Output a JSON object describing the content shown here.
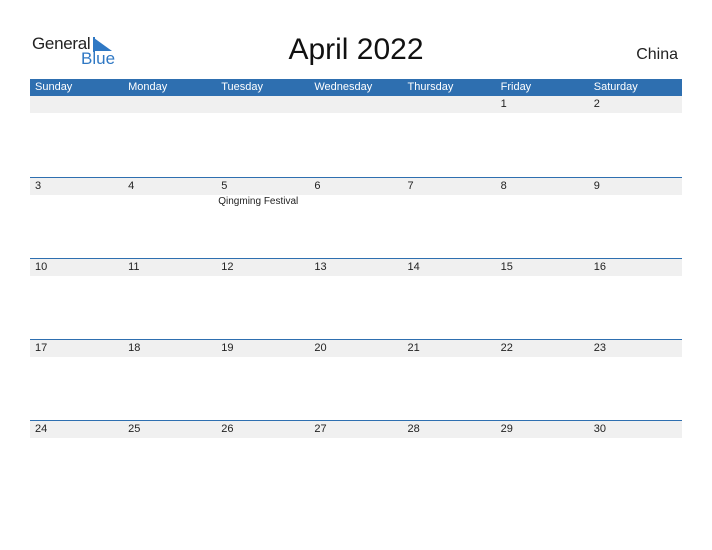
{
  "logo": {
    "word1": "General",
    "word2": "Blue"
  },
  "title": "April 2022",
  "country": "China",
  "colors": {
    "accent": "#2e6fb0",
    "strip": "#f0f0f0"
  },
  "weekdays": [
    "Sunday",
    "Monday",
    "Tuesday",
    "Wednesday",
    "Thursday",
    "Friday",
    "Saturday"
  ],
  "weeks": [
    {
      "days": [
        "",
        "",
        "",
        "",
        "",
        "1",
        "2"
      ],
      "events": [
        "",
        "",
        "",
        "",
        "",
        "",
        ""
      ]
    },
    {
      "days": [
        "3",
        "4",
        "5",
        "6",
        "7",
        "8",
        "9"
      ],
      "events": [
        "",
        "",
        "Qingming Festival",
        "",
        "",
        "",
        ""
      ]
    },
    {
      "days": [
        "10",
        "11",
        "12",
        "13",
        "14",
        "15",
        "16"
      ],
      "events": [
        "",
        "",
        "",
        "",
        "",
        "",
        ""
      ]
    },
    {
      "days": [
        "17",
        "18",
        "19",
        "20",
        "21",
        "22",
        "23"
      ],
      "events": [
        "",
        "",
        "",
        "",
        "",
        "",
        ""
      ]
    },
    {
      "days": [
        "24",
        "25",
        "26",
        "27",
        "28",
        "29",
        "30"
      ],
      "events": [
        "",
        "",
        "",
        "",
        "",
        "",
        ""
      ]
    }
  ]
}
